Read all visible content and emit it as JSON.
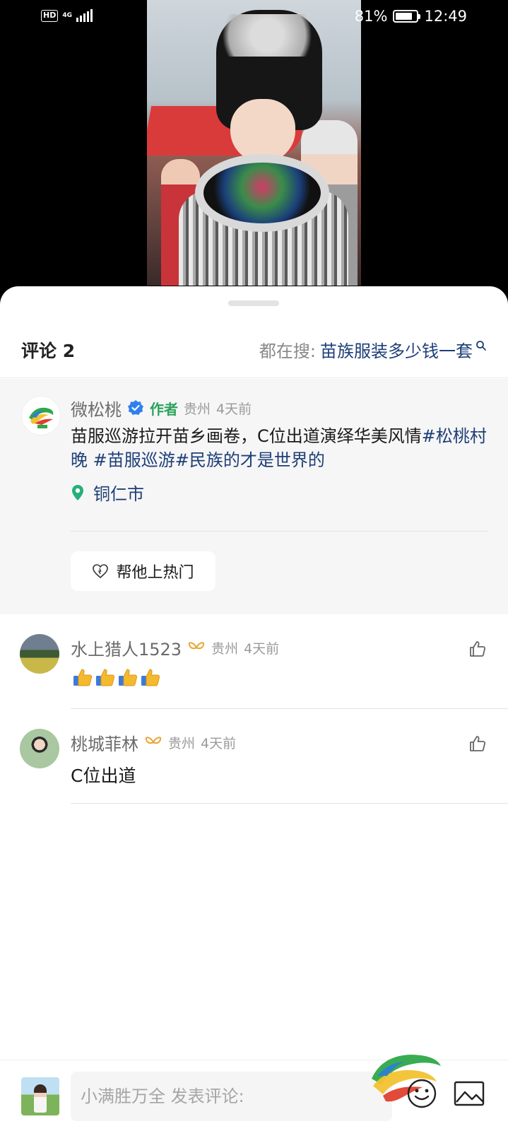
{
  "status_bar": {
    "hd": "HD",
    "network": "4G",
    "battery": "81%",
    "battery_level": 0.81,
    "time": "12:49"
  },
  "comments_panel": {
    "title": "评论 2",
    "search_prefix": "都在搜:",
    "search_term": "苗族服装多少钱一套"
  },
  "author_post": {
    "name": "微松桃",
    "author_tag": "作者",
    "region": "贵州",
    "time": "4天前",
    "text_plain": "苗服巡游拉开苗乡画卷，C位出道演绎华美风情",
    "hashtag_1": "#松桃村晚",
    "hashtag_2": "#苗服巡游",
    "hashtag_3": "#民族的才是世界的",
    "location": "铜仁市",
    "boost_label": "帮他上热门"
  },
  "comments": [
    {
      "name": "水上猎人1523",
      "region": "贵州",
      "time": "4天前",
      "text": "",
      "thumbs_count": 4
    },
    {
      "name": "桃城菲林",
      "region": "贵州",
      "time": "4天前",
      "text": "C位出道"
    }
  ],
  "composer": {
    "placeholder": "小满胜万全 发表评论:"
  },
  "colors": {
    "accent": "#1d3f77",
    "author_tag": "#2aa35a",
    "location_pin": "#25b07a",
    "verified": "#2f80ed",
    "fan_badge": "#e6a534"
  },
  "icons": [
    "search-icon",
    "verified-icon",
    "location-pin-icon",
    "heart-fire-icon",
    "like-icon",
    "fan-badge-icon",
    "emoji-icon",
    "image-icon",
    "thumbs-up-emoji"
  ]
}
